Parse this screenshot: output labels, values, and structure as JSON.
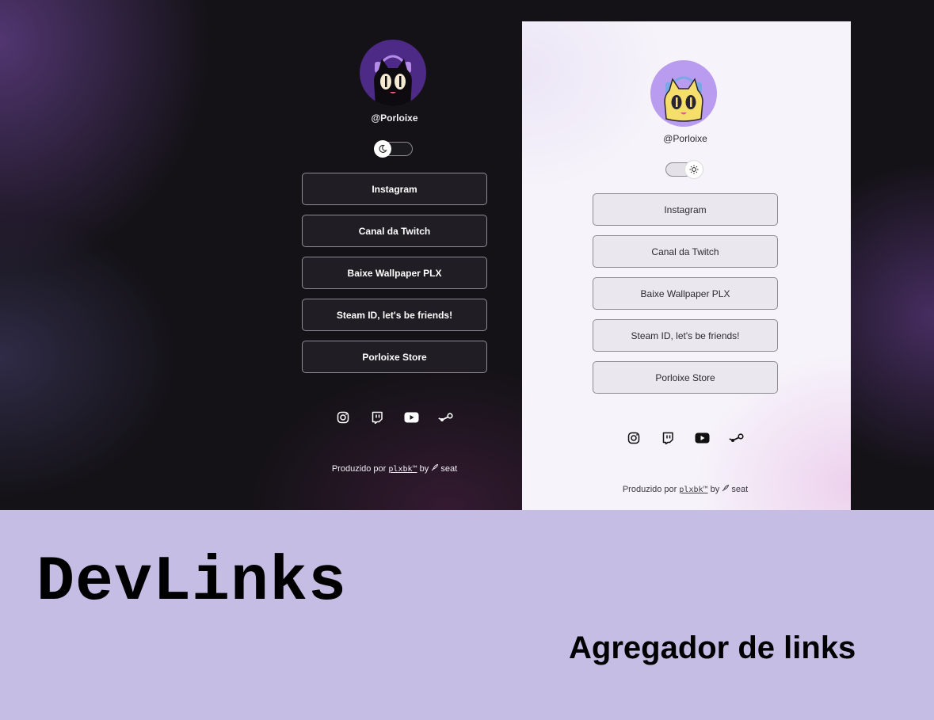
{
  "colors": {
    "dark_bg": "#141217",
    "light_panel_bg": "#f6f3fa",
    "bottom_band": "#c5bde4",
    "dark_avatar_bg": "#4c2a86",
    "light_avatar_bg": "#b99cf0"
  },
  "dark_profile": {
    "handle": "@Porloixe",
    "theme_toggle_icon": "moon-icon",
    "links": [
      {
        "label": "Instagram"
      },
      {
        "label": "Canal da Twitch"
      },
      {
        "label": "Baixe Wallpaper PLX"
      },
      {
        "label": "Steam ID, let's be friends!"
      },
      {
        "label": "Porloixe Store"
      }
    ],
    "social_icons": [
      "instagram-icon",
      "twitch-icon",
      "youtube-icon",
      "steam-icon"
    ],
    "footer": {
      "prefix": "Produzido por",
      "brand": "plxbk™",
      "middle": "by",
      "tail": "seat"
    }
  },
  "light_profile": {
    "handle": "@Porloixe",
    "theme_toggle_icon": "sun-icon",
    "links": [
      {
        "label": "Instagram"
      },
      {
        "label": "Canal da Twitch"
      },
      {
        "label": "Baixe Wallpaper PLX"
      },
      {
        "label": "Steam ID, let's be friends!"
      },
      {
        "label": "Porloixe Store"
      }
    ],
    "social_icons": [
      "instagram-icon",
      "twitch-icon",
      "youtube-icon",
      "steam-icon"
    ],
    "footer": {
      "prefix": "Produzido por",
      "brand": "plxbk™",
      "middle": "by",
      "tail": "seat"
    }
  },
  "banner": {
    "title": "DevLinks",
    "subtitle": "Agregador de links"
  }
}
